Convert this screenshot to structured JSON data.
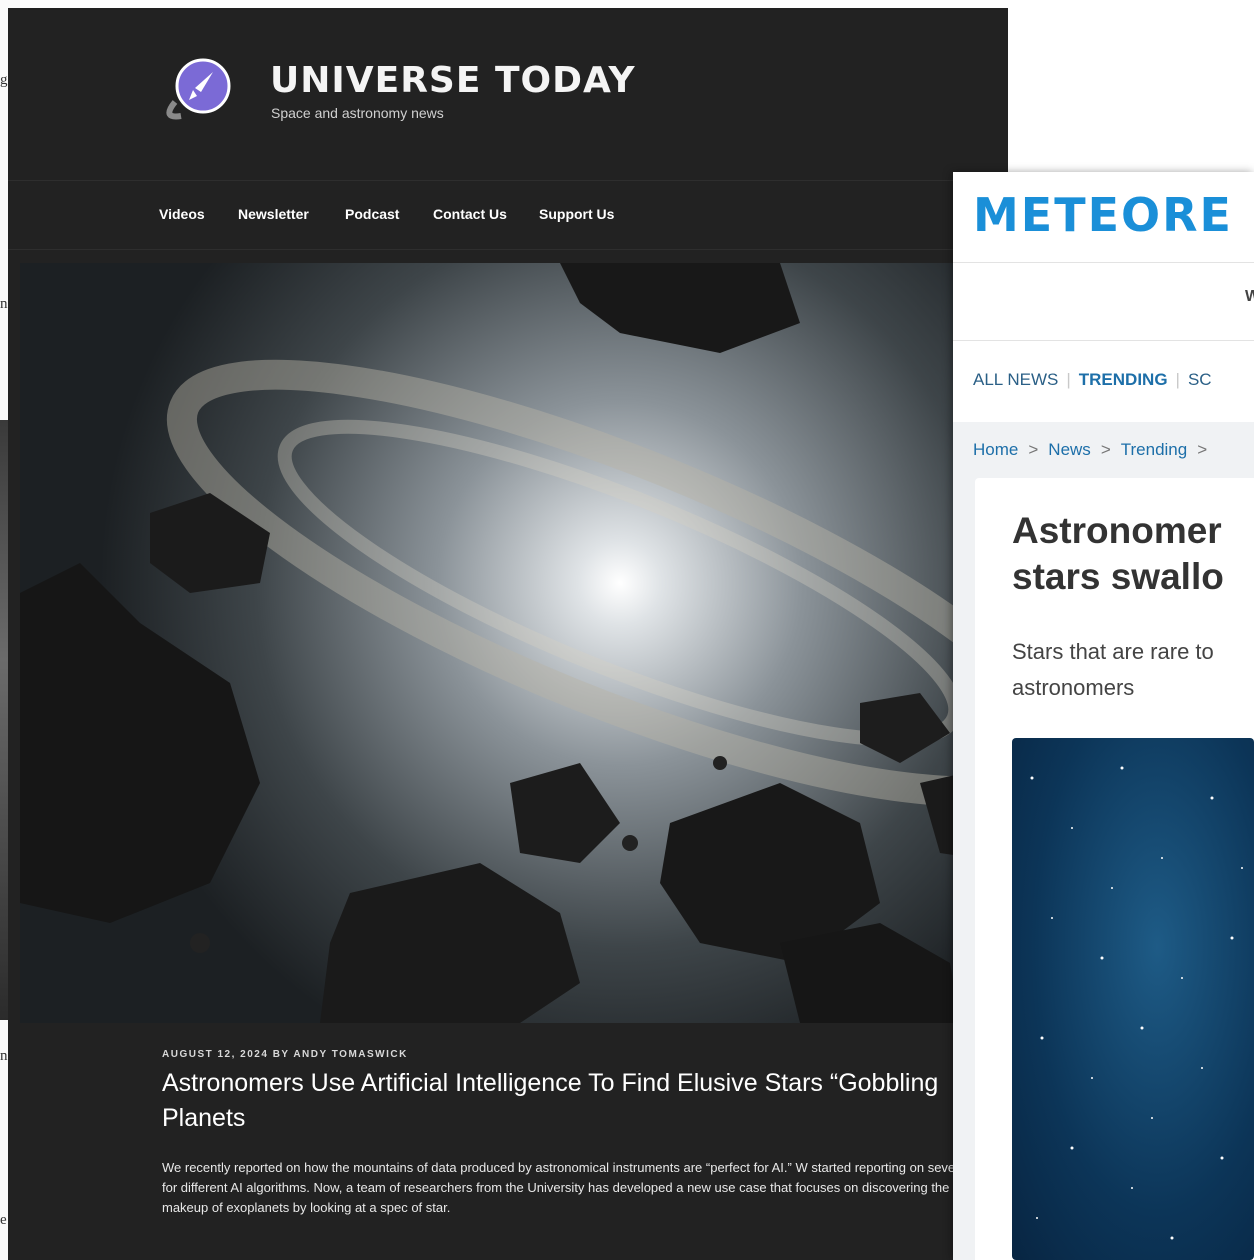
{
  "background_window": {
    "fragments": [
      "g",
      "n",
      "ne",
      "e"
    ]
  },
  "universe_today": {
    "site_title": "UNIVERSE TODAY",
    "tagline": "Space and astronomy news",
    "nav": [
      "Videos",
      "Newsletter",
      "Podcast",
      "Contact Us",
      "Support Us"
    ],
    "article": {
      "meta": "AUGUST 12, 2024 BY ANDY TOMASWICK",
      "headline": "Astronomers Use Artificial Intelligence To Find Elusive Stars “Gobbling\nPlanets",
      "excerpt": "We recently reported on how the mountains of data produced by astronomical instruments are “perfect for AI.” W started reporting on several use cases for different AI algorithms. Now, a team of researchers from the University has developed a new use case that focuses on discovering the interior makeup of exoplanets by looking at a spec of star."
    },
    "colors": {
      "background": "#222222",
      "logo_circle": "#7b6ad6"
    }
  },
  "meteored": {
    "logo": "METEORE",
    "top_partial": "W",
    "categories": [
      "ALL NEWS",
      "TRENDING",
      "SC"
    ],
    "breadcrumbs": [
      "Home",
      "News",
      "Trending"
    ],
    "article": {
      "title": "Astronomer\nstars swallo",
      "subtitle": "Stars that are rare to\nastronomers"
    },
    "colors": {
      "brand": "#1a8fd8",
      "link": "#1d6fa9"
    }
  }
}
